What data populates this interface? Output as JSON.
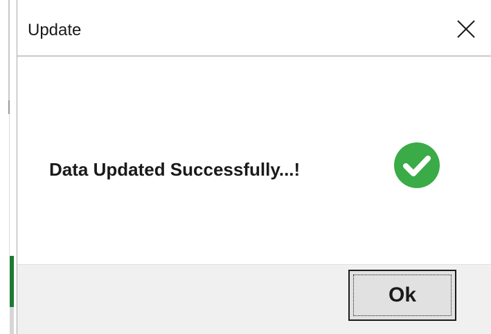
{
  "dialog": {
    "title": "Update",
    "close_icon": "close-icon",
    "message": "Data Updated Successfully...!",
    "status_icon": "check-circle-icon",
    "status_color": "#3aab47",
    "ok_label": "Ok"
  }
}
